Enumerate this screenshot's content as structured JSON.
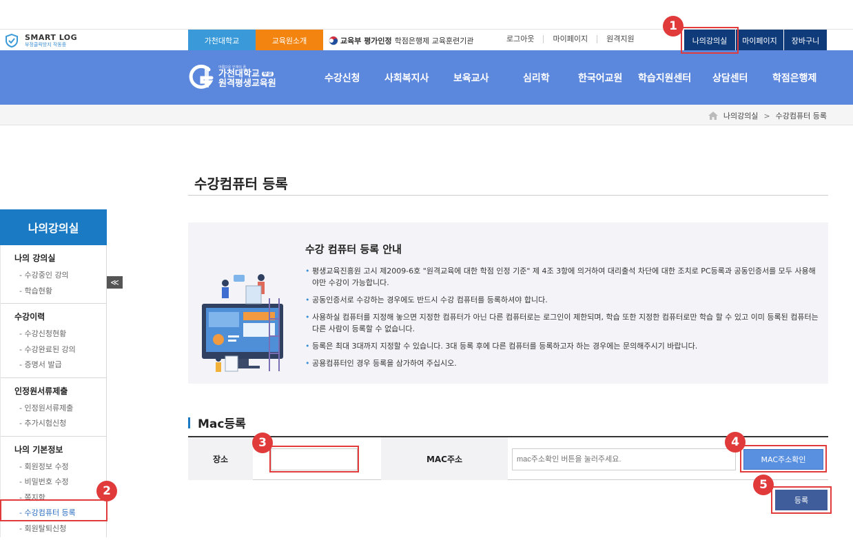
{
  "smartlog": {
    "name": "SMART LOG",
    "status": "부정클릭방지 작동중"
  },
  "topbar": {
    "univ": "가천대학교",
    "intro": "교육원소개",
    "cert_bold": "교육부 평가인정",
    "cert_rest": "학점은행제 교육훈련기관",
    "links": [
      "로그아웃",
      "마이페이지",
      "원격지원"
    ],
    "navy": [
      "나의강의실",
      "마이페이지",
      "장바구니"
    ]
  },
  "logo": {
    "tagline": "아름다운 인재의 꿈",
    "line1": "가천대학교",
    "badge": "부설",
    "line2": "원격평생교육원"
  },
  "menu": [
    "수강신청",
    "사회복지사",
    "보육교사",
    "심리학",
    "한국어교원",
    "학습지원센터",
    "상담센터",
    "학점은행제"
  ],
  "breadcrumb": {
    "parent": "나의강의실",
    "sep": ">",
    "current": "수강컴퓨터 등록"
  },
  "sidebar": {
    "title": "나의강의실",
    "groups": [
      {
        "title": "나의 강의실",
        "items": [
          "- 수강중인 강의",
          "- 학습현황"
        ]
      },
      {
        "title": "수강이력",
        "items": [
          "- 수강신청현황",
          "- 수강완료된 강의",
          "- 증명서 발급"
        ]
      },
      {
        "title": "인정원서류제출",
        "items": [
          "- 인정원서류제출",
          "- 추가시험신청"
        ]
      },
      {
        "title": "나의 기본정보",
        "items": [
          "- 회원정보 수정",
          "- 비밀번호 수정",
          "- 쪽지함",
          "- 수강컴퓨터 등록",
          "- 회원탈퇴신청"
        ]
      }
    ],
    "collapse": "≪"
  },
  "page": {
    "title": "수강컴퓨터 등록"
  },
  "guide": {
    "title": "수강 컴퓨터 등록 안내",
    "items": [
      "평생교육진흥원 고시 제2009-6호 \"원격교육에 대한 학점 인정 기준\" 제 4조 3항에 의거하여 대리출석 차단에 대한 조치로 PC등록과 공동인증서를 모두 사용해야만 수강이 가능합니다.",
      "공동인증서로 수강하는 경우에도 반드시 수강 컴퓨터를 등록하셔야 합니다.",
      "사용하실 컴퓨터를 지정해 놓으면 지정한 컴퓨터가 아닌 다른 컴퓨터로는 로그인이 제한되며, 학습 또한 지정한 컴퓨터로만 학습 할 수 있고 이미 등록된 컴퓨터는 다른 사람이 등록할 수 없습니다.",
      "등록은 최대 3대까지 지정할 수 있습니다. 3대 등록 후에 다른 컴퓨터를 등록하고자 하는 경우에는 문의해주시기 바랍니다.",
      "공용컴퓨터인 경우 등록을 삼가하여 주십시오."
    ]
  },
  "mac": {
    "section_title": "Mac등록",
    "place_label": "장소",
    "place_value": "",
    "mac_label": "MAC주소",
    "mac_placeholder": "mac주소확인 버튼을 눌러주세요.",
    "check_button": "MAC주소확인",
    "submit_button": "등록"
  },
  "annotations": [
    "1",
    "2",
    "3",
    "4",
    "5"
  ],
  "colors": {
    "nav_blue": "#5b87dd",
    "navy": "#0f3b7b",
    "sidebar_blue": "#1b7ac4",
    "orange": "#f3840f",
    "highlight_red": "#e03a3a"
  }
}
